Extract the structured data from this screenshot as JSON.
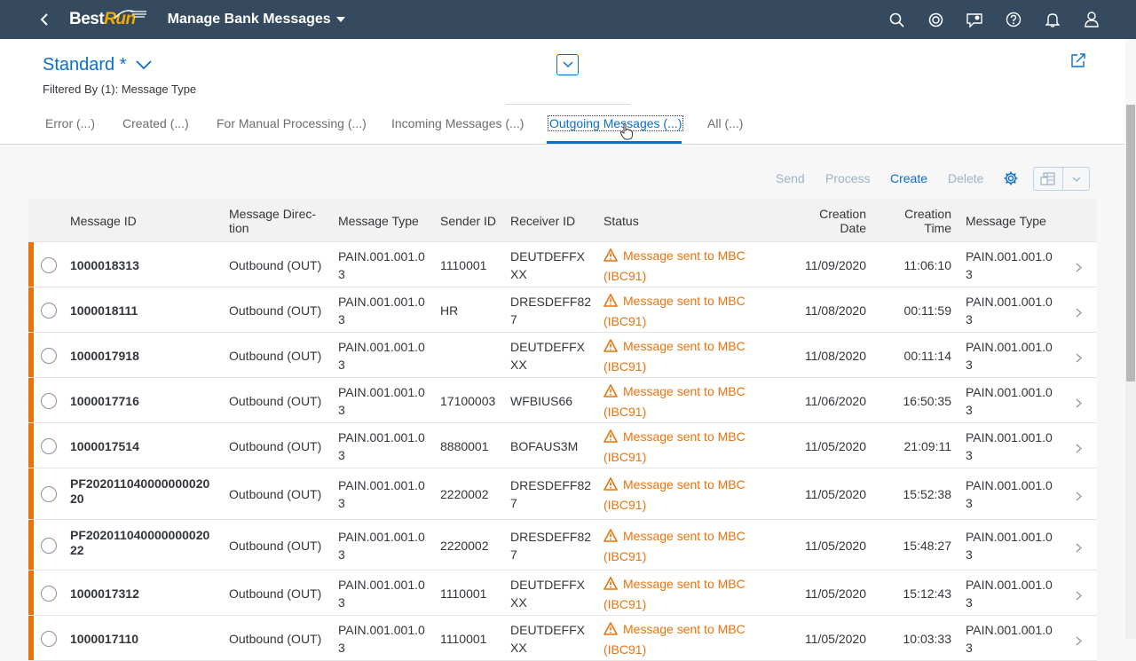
{
  "shell": {
    "logo_best": "Best",
    "logo_run": "Run",
    "app_title": "Manage Bank Messages",
    "icons": [
      "search-icon",
      "copilot-icon",
      "notifications-feed-icon",
      "help-icon",
      "bell-icon",
      "user-icon"
    ]
  },
  "header": {
    "variant": "Standard *",
    "filtered_by": "Filtered By (1): Message Type"
  },
  "tabs": [
    {
      "label": "Error (...)",
      "active": false
    },
    {
      "label": "Created (...)",
      "active": false
    },
    {
      "label": "For Manual Processing (...)",
      "active": false
    },
    {
      "label": "Incoming Messages (...)",
      "active": false
    },
    {
      "label": "Outgoing Messages (...)",
      "active": true
    },
    {
      "label": "All (...)",
      "active": false
    }
  ],
  "toolbar": {
    "send": "Send",
    "process": "Process",
    "create": "Create",
    "delete": "Delete"
  },
  "columns": {
    "message_id": "Message ID",
    "direction": "Message Direc-tion",
    "message_type": "Message Type",
    "sender_id": "Sender ID",
    "receiver_id": "Receiver ID",
    "status": "Status",
    "creation_date": "Creation Date",
    "creation_time": "Creation Time",
    "message_type2": "Message Type"
  },
  "rows": [
    {
      "id": "1000018313",
      "dir": "Outbound (OUT)",
      "type": "PAIN.001.001.03",
      "sender": "1110001",
      "receiver": "DEUTDEFFXXX",
      "status": "Message sent to MBC (IBC91)",
      "date": "11/09/2020",
      "time": "11:06:10",
      "type2": "PAIN.001.001.03"
    },
    {
      "id": "1000018111",
      "dir": "Outbound (OUT)",
      "type": "PAIN.001.001.03",
      "sender": "HR",
      "receiver": "DRESDEFF827",
      "status": "Message sent to MBC (IBC91)",
      "date": "11/08/2020",
      "time": "00:11:59",
      "type2": "PAIN.001.001.03"
    },
    {
      "id": "1000017918",
      "dir": "Outbound (OUT)",
      "type": "PAIN.001.001.03",
      "sender": "",
      "receiver": "DEUTDEFFXXX",
      "status": "Message sent to MBC (IBC91)",
      "date": "11/08/2020",
      "time": "00:11:14",
      "type2": "PAIN.001.001.03"
    },
    {
      "id": "1000017716",
      "dir": "Outbound (OUT)",
      "type": "PAIN.001.001.03",
      "sender": "17100003",
      "receiver": "WFBIUS66",
      "status": "Message sent to MBC (IBC91)",
      "date": "11/06/2020",
      "time": "16:50:35",
      "type2": "PAIN.001.001.03"
    },
    {
      "id": "1000017514",
      "dir": "Outbound (OUT)",
      "type": "PAIN.001.001.03",
      "sender": "8880001",
      "receiver": "BOFAUS3M",
      "status": "Message sent to MBC (IBC91)",
      "date": "11/05/2020",
      "time": "21:09:11",
      "type2": "PAIN.001.001.03"
    },
    {
      "id": "PF20201104000000002020",
      "dir": "Outbound (OUT)",
      "type": "PAIN.001.001.03",
      "sender": "2220002",
      "receiver": "DRESDEFF827",
      "status": "Message sent to MBC (IBC91)",
      "date": "11/05/2020",
      "time": "15:52:38",
      "type2": "PAIN.001.001.03"
    },
    {
      "id": "PF20201104000000002022",
      "dir": "Outbound (OUT)",
      "type": "PAIN.001.001.03",
      "sender": "2220002",
      "receiver": "DRESDEFF827",
      "status": "Message sent to MBC (IBC91)",
      "date": "11/05/2020",
      "time": "15:48:27",
      "type2": "PAIN.001.001.03"
    },
    {
      "id": "1000017312",
      "dir": "Outbound (OUT)",
      "type": "PAIN.001.001.03",
      "sender": "1110001",
      "receiver": "DEUTDEFFXXX",
      "status": "Message sent to MBC (IBC91)",
      "date": "11/05/2020",
      "time": "15:12:43",
      "type2": "PAIN.001.001.03"
    },
    {
      "id": "1000017110",
      "dir": "Outbound (OUT)",
      "type": "PAIN.001.001.03",
      "sender": "1110001",
      "receiver": "DEUTDEFFXXX",
      "status": "Message sent to MBC (IBC91)",
      "date": "11/05/2020",
      "time": "10:03:33",
      "type2": "PAIN.001.001.03"
    }
  ],
  "colors": {
    "shell_bg": "#354a5f",
    "accent": "#0a6ed1",
    "warning": "#e9730c"
  }
}
